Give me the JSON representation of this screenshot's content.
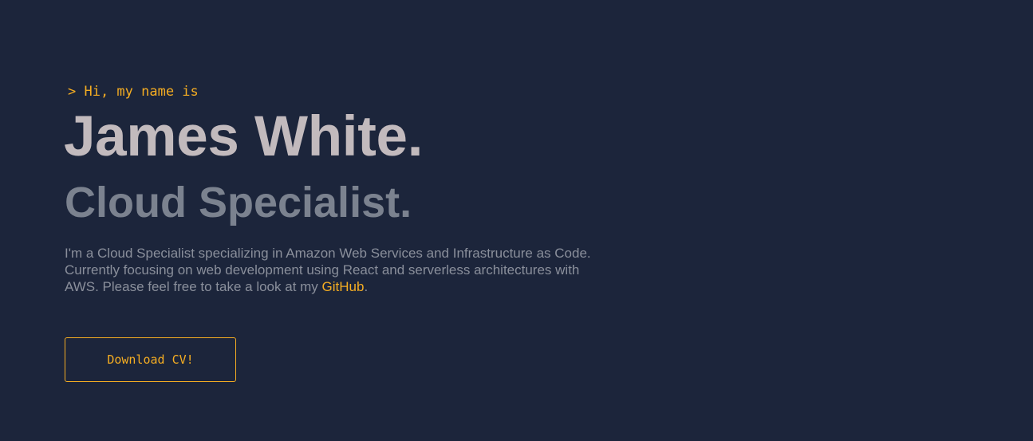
{
  "hero": {
    "greeting": "> Hi, my name is",
    "name": "James White.",
    "role": "Cloud Specialist.",
    "bio_text": "I'm a Cloud Specialist specializing in Amazon Web Services and Infrastructure as Code. Currently focusing on web development using React and serverless architectures with AWS. Please feel free to take a look at my ",
    "bio_link": "GitHub",
    "bio_end": ".",
    "cta_label": "Download CV!"
  },
  "colors": {
    "background": "#1c253b",
    "accent": "#f5ad22",
    "name": "#c2babd",
    "role": "#7b828f",
    "body_text": "#8a8f9b"
  }
}
